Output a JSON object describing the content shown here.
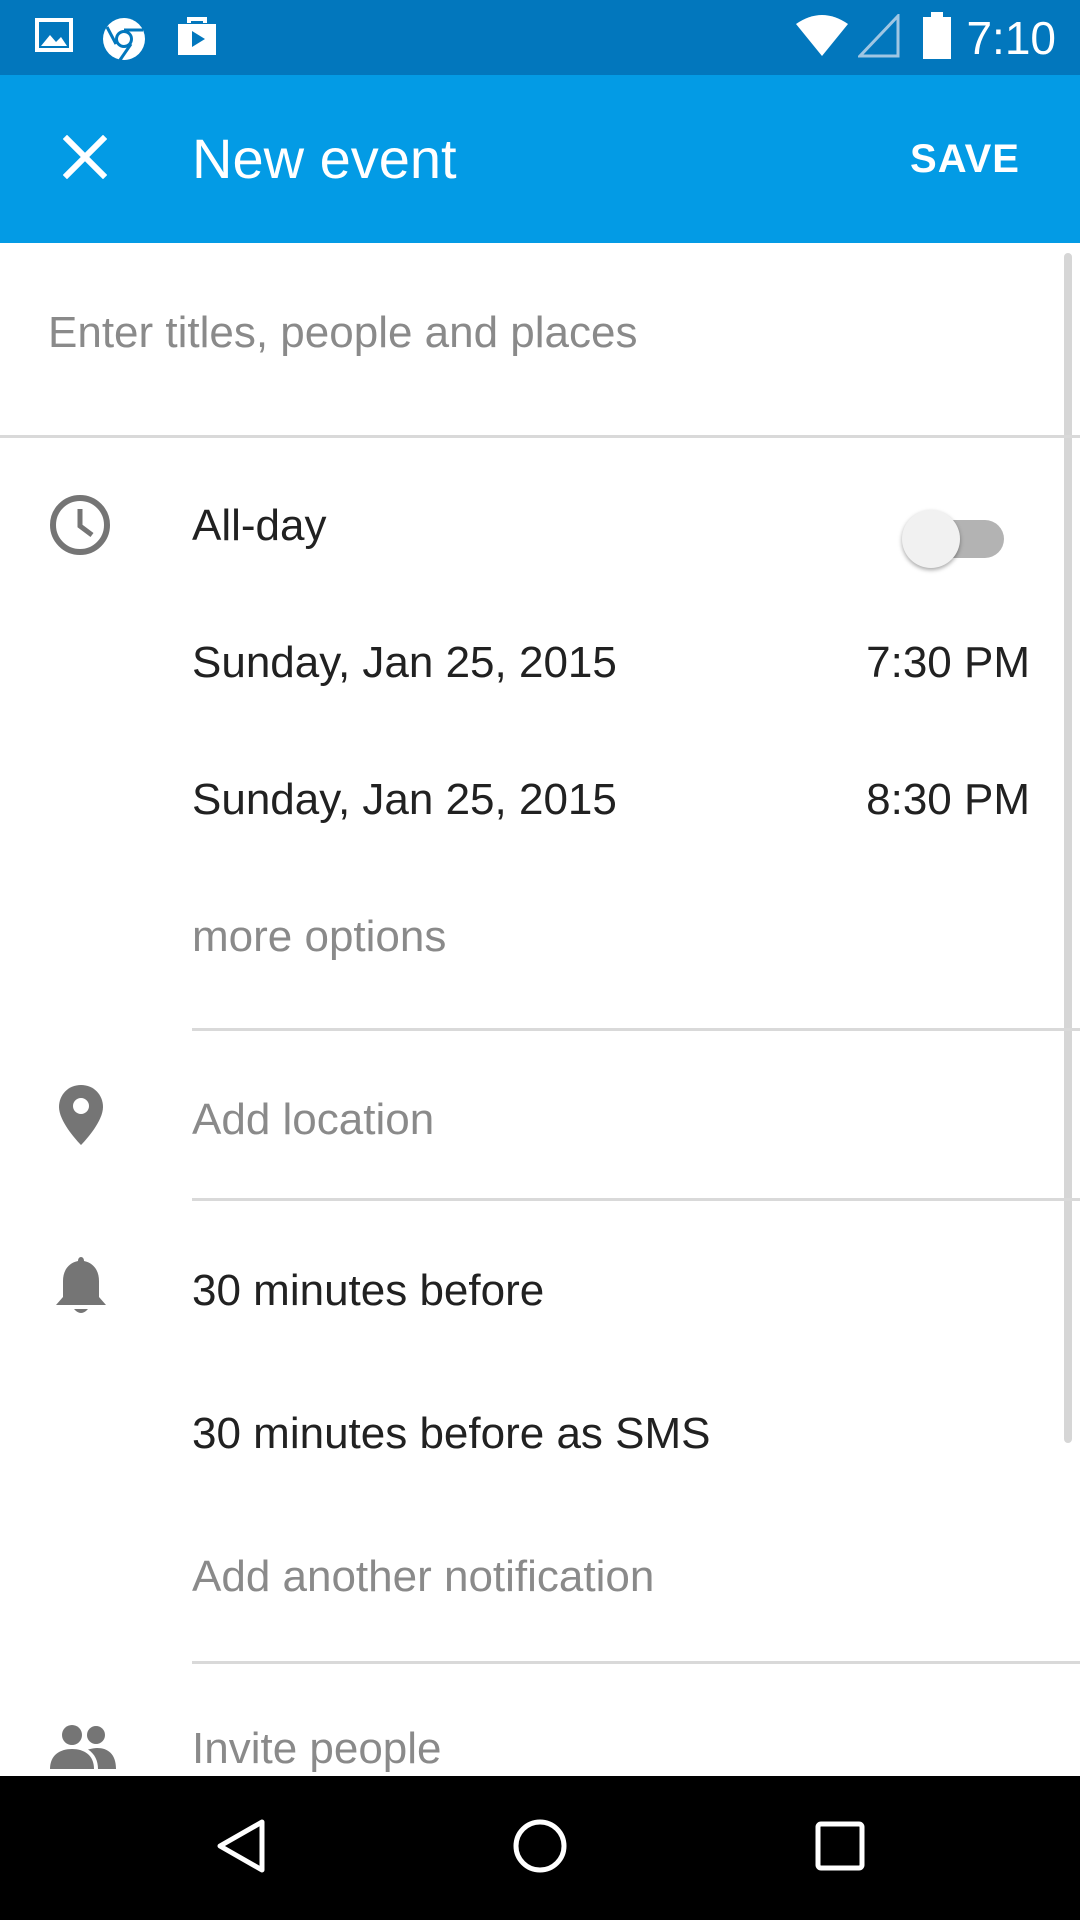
{
  "status_bar": {
    "time": "7:10",
    "left_icons": [
      "image-icon",
      "chrome-icon",
      "play-store-icon"
    ],
    "right_icons": [
      "wifi-icon",
      "cell-signal-icon",
      "battery-icon"
    ]
  },
  "app_bar": {
    "title": "New event",
    "save_label": "SAVE",
    "close_icon": "close-icon",
    "background": "#039be5"
  },
  "form": {
    "title_placeholder": "Enter titles, people and places",
    "all_day_label": "All-day",
    "all_day_on": false,
    "start_date": "Sunday, Jan 25, 2015",
    "start_time": "7:30 PM",
    "end_date": "Sunday, Jan 25, 2015",
    "end_time": "8:30 PM",
    "more_options": "more options",
    "location_placeholder": "Add location",
    "notifications": [
      "30 minutes before",
      "30 minutes before as SMS"
    ],
    "add_notification": "Add another notification",
    "invite_people": "Invite people"
  },
  "nav_bar": {
    "buttons": [
      "back-icon",
      "home-icon",
      "recents-icon"
    ]
  },
  "colors": {
    "status_bar": "#0277bd",
    "app_bar": "#039be5",
    "primary_text": "#212121",
    "secondary_text": "#8a8a8a",
    "icon_gray": "#757575"
  }
}
